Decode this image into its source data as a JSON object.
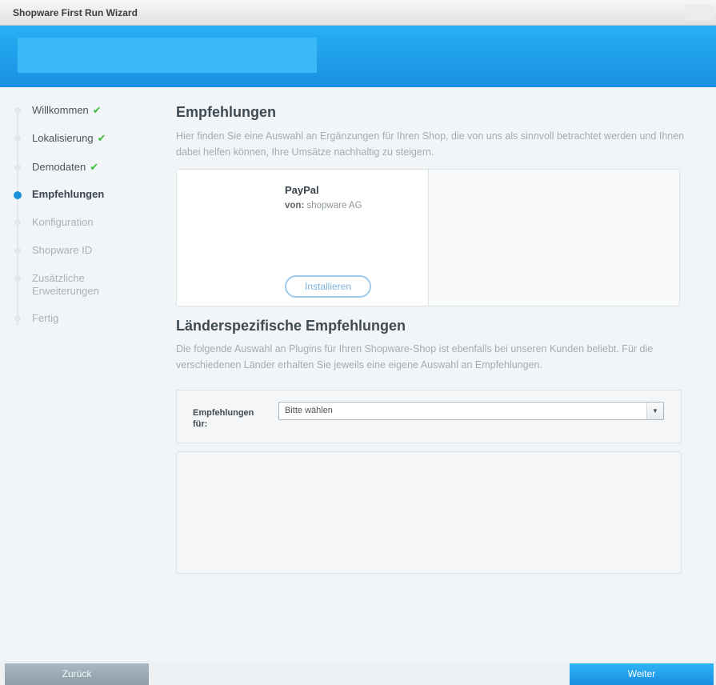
{
  "window": {
    "title": "Shopware First Run Wizard"
  },
  "nav": {
    "items": [
      {
        "label": "Willkommen",
        "state": "done"
      },
      {
        "label": "Lokalisierung",
        "state": "done"
      },
      {
        "label": "Demodaten",
        "state": "done"
      },
      {
        "label": "Empfehlungen",
        "state": "active"
      },
      {
        "label": "Konfiguration",
        "state": "pending"
      },
      {
        "label": "Shopware ID",
        "state": "pending"
      },
      {
        "label": "Zusätzliche Erweiterungen",
        "state": "pending"
      },
      {
        "label": "Fertig",
        "state": "pending"
      }
    ],
    "check_glyph": "✔"
  },
  "recommendations": {
    "heading": "Empfehlungen",
    "description": "Hier finden Sie eine Auswahl an Ergänzungen für Ihren Shop, die von uns als sinnvoll betrachtet werden und Ihnen dabei helfen können, Ihre Umsätze nachhaltig zu steigern.",
    "plugin": {
      "name": "PayPal",
      "vendor_prefix": "von:",
      "vendor": "shopware AG",
      "install_label": "Installieren"
    }
  },
  "country": {
    "heading": "Länderspezifische Empfehlungen",
    "description": "Die folgende Auswahl an Plugins für Ihren Shopware-Shop ist ebenfalls bei unseren Kunden beliebt. Für die verschiedenen Länder erhalten Sie jeweils eine eigene Auswahl an Empfehlungen.",
    "filter_label": "Empfehlungen für:",
    "select_value": "Bitte wählen"
  },
  "footer": {
    "back_label": "Zurück",
    "next_label": "Weiter"
  },
  "colors": {
    "accent": "#1a8fe2",
    "done_check": "#3fbe3f",
    "active_dot": "#1990d8"
  }
}
